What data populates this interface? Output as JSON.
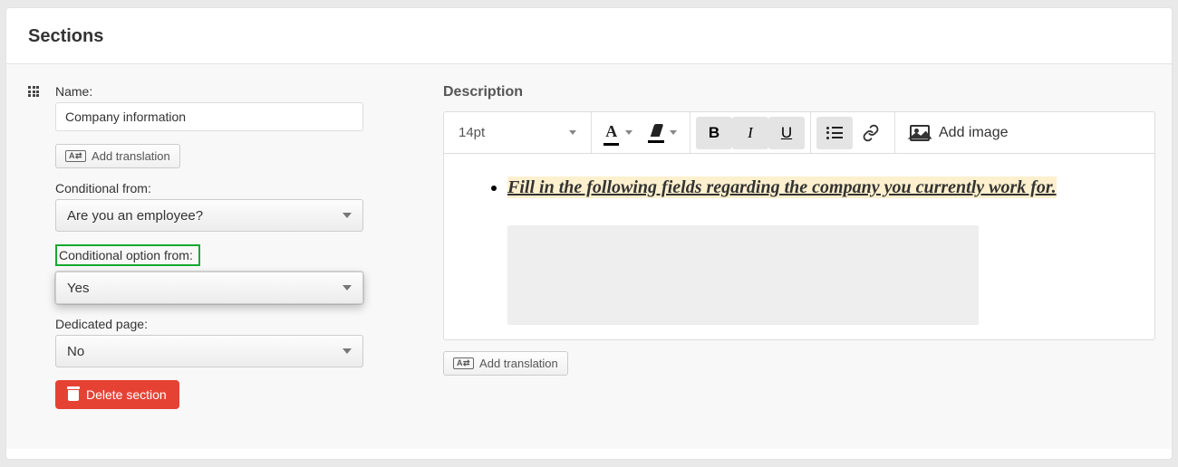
{
  "header": {
    "title": "Sections"
  },
  "left": {
    "name_label": "Name:",
    "name_value": "Company information",
    "add_translation": "Add translation",
    "conditional_from_label": "Conditional from:",
    "conditional_from_value": "Are you an employee?",
    "conditional_option_label": "Conditional option from:",
    "conditional_option_value": "Yes",
    "dedicated_page_label": "Dedicated page:",
    "dedicated_page_value": "No",
    "delete_label": "Delete section"
  },
  "right": {
    "description_label": "Description",
    "font_size": "14pt",
    "add_image_label": "Add image",
    "content": "Fill in the following fields regarding the company you currently work for.",
    "add_translation": "Add translation"
  }
}
